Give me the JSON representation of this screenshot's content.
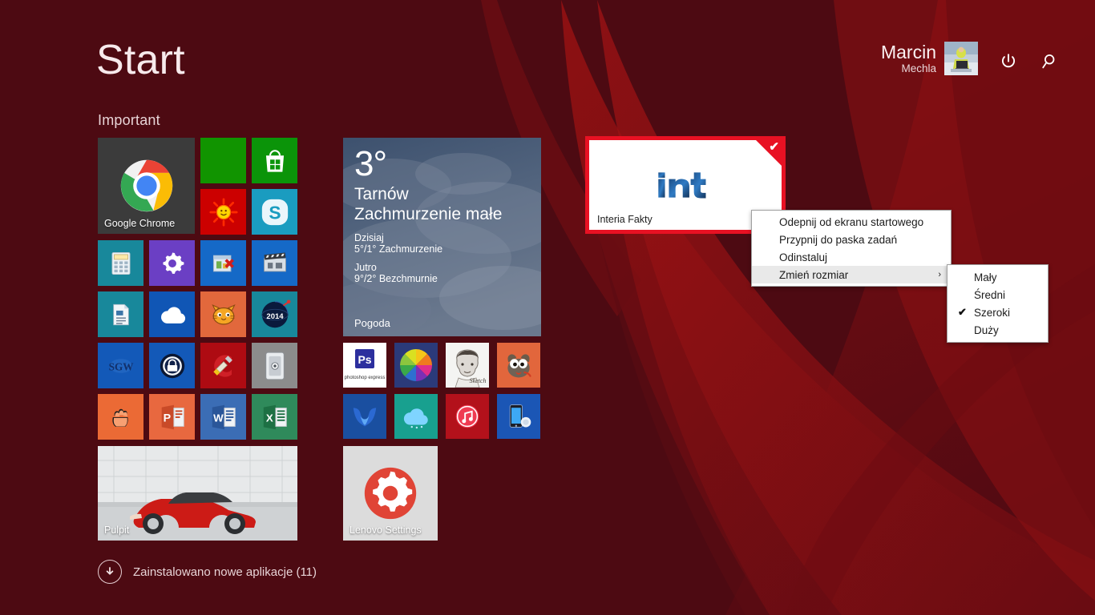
{
  "screen": {
    "title": "Start",
    "background_color": "#4d0a12",
    "accent_color": "#e81123"
  },
  "account": {
    "first_name": "Marcin",
    "last_name": "Mechla",
    "avatar_icon": "user-photo",
    "power_icon": "power-icon",
    "search_icon": "search-icon"
  },
  "groups": [
    {
      "title": "Important"
    },
    {
      "title": ""
    }
  ],
  "tiles": {
    "chrome": {
      "label": "Google Chrome",
      "icon": "google-chrome-icon"
    },
    "green_blank": {
      "label": "",
      "icon": "blank-green-tile"
    },
    "store": {
      "label": "",
      "icon": "windows-store-icon"
    },
    "sun": {
      "label": "",
      "icon": "sun-smiley-icon"
    },
    "skype": {
      "label": "",
      "icon": "skype-icon"
    },
    "calculator": {
      "label": "",
      "icon": "calculator-icon"
    },
    "settings": {
      "label": "",
      "icon": "gear-icon"
    },
    "uninstaller": {
      "label": "",
      "icon": "uninstaller-icon"
    },
    "movie_maker": {
      "label": "",
      "icon": "movie-clapper-icon"
    },
    "writer": {
      "label": "",
      "icon": "document-icon"
    },
    "onedrive": {
      "label": "",
      "icon": "onedrive-cloud-icon"
    },
    "scratch": {
      "label": "",
      "icon": "scratch-cat-icon"
    },
    "fifa2014": {
      "label": "",
      "icon": "globe-2014-icon"
    },
    "sgw": {
      "label": "",
      "icon": "sgw-icon"
    },
    "keepass": {
      "label": "",
      "icon": "keepass-lock-icon"
    },
    "ccleaner": {
      "label": "",
      "icon": "ccleaner-icon"
    },
    "lockpick": {
      "label": "",
      "icon": "lock-device-icon"
    },
    "handball": {
      "label": "",
      "icon": "glove-icon"
    },
    "powerpoint": {
      "label": "",
      "icon": "powerpoint-icon"
    },
    "word": {
      "label": "",
      "icon": "word-icon"
    },
    "excel": {
      "label": "",
      "icon": "excel-icon"
    },
    "pulpit": {
      "label": "Pulpit",
      "icon": "desktop-car-thumbnail"
    },
    "photoshop_express": {
      "label": "",
      "icon": "photoshop-express-icon"
    },
    "color_wheel": {
      "label": "",
      "icon": "color-pinwheel-icon"
    },
    "sketch": {
      "label": "",
      "icon": "sketch-portrait-icon"
    },
    "gimp": {
      "label": "",
      "icon": "gimp-wilber-icon"
    },
    "malwarebytes": {
      "label": "",
      "icon": "malwarebytes-icon"
    },
    "cloud_teal": {
      "label": "",
      "icon": "cloud-icon"
    },
    "itunes": {
      "label": "",
      "icon": "itunes-music-note-icon"
    },
    "phone_companion": {
      "label": "",
      "icon": "phone-sync-icon"
    },
    "lenovo_settings": {
      "label": "Lenovo Settings",
      "icon": "lenovo-gear-icon"
    },
    "interia": {
      "label": "Interia Fakty",
      "icon": "interia-int-logo",
      "selected": true,
      "check_icon": "checkmark-icon"
    }
  },
  "weather": {
    "temperature": "3°",
    "city": "Tarnów",
    "condition": "Zachmurzenie małe",
    "today_label": "Dzisiaj",
    "today_value": "5°/1° Zachmurzenie",
    "tomorrow_label": "Jutro",
    "tomorrow_value": "9°/2° Bezchmurnie",
    "app_name": "Pogoda"
  },
  "context_menu": {
    "items": [
      {
        "label": "Odepnij od ekranu startowego",
        "accel": "O",
        "selected": false,
        "submenu": false
      },
      {
        "label": "Przypnij do paska zadań",
        "accel": "P",
        "selected": false,
        "submenu": false
      },
      {
        "label": "Odinstaluj",
        "accel": "O",
        "selected": false,
        "submenu": false
      },
      {
        "label": "Zmień rozmiar",
        "accel": "Z",
        "selected": true,
        "submenu": true
      }
    ],
    "submenu_chevron": "›",
    "submenu": {
      "items": [
        {
          "label": "Mały",
          "checked": false
        },
        {
          "label": "Średni",
          "checked": false
        },
        {
          "label": "Szeroki",
          "checked": true
        },
        {
          "label": "Duży",
          "checked": false
        }
      ],
      "check_glyph": "✔"
    }
  },
  "notification": {
    "text": "Zainstalowano nowe aplikacje (11)",
    "icon": "download-arrow-icon"
  }
}
